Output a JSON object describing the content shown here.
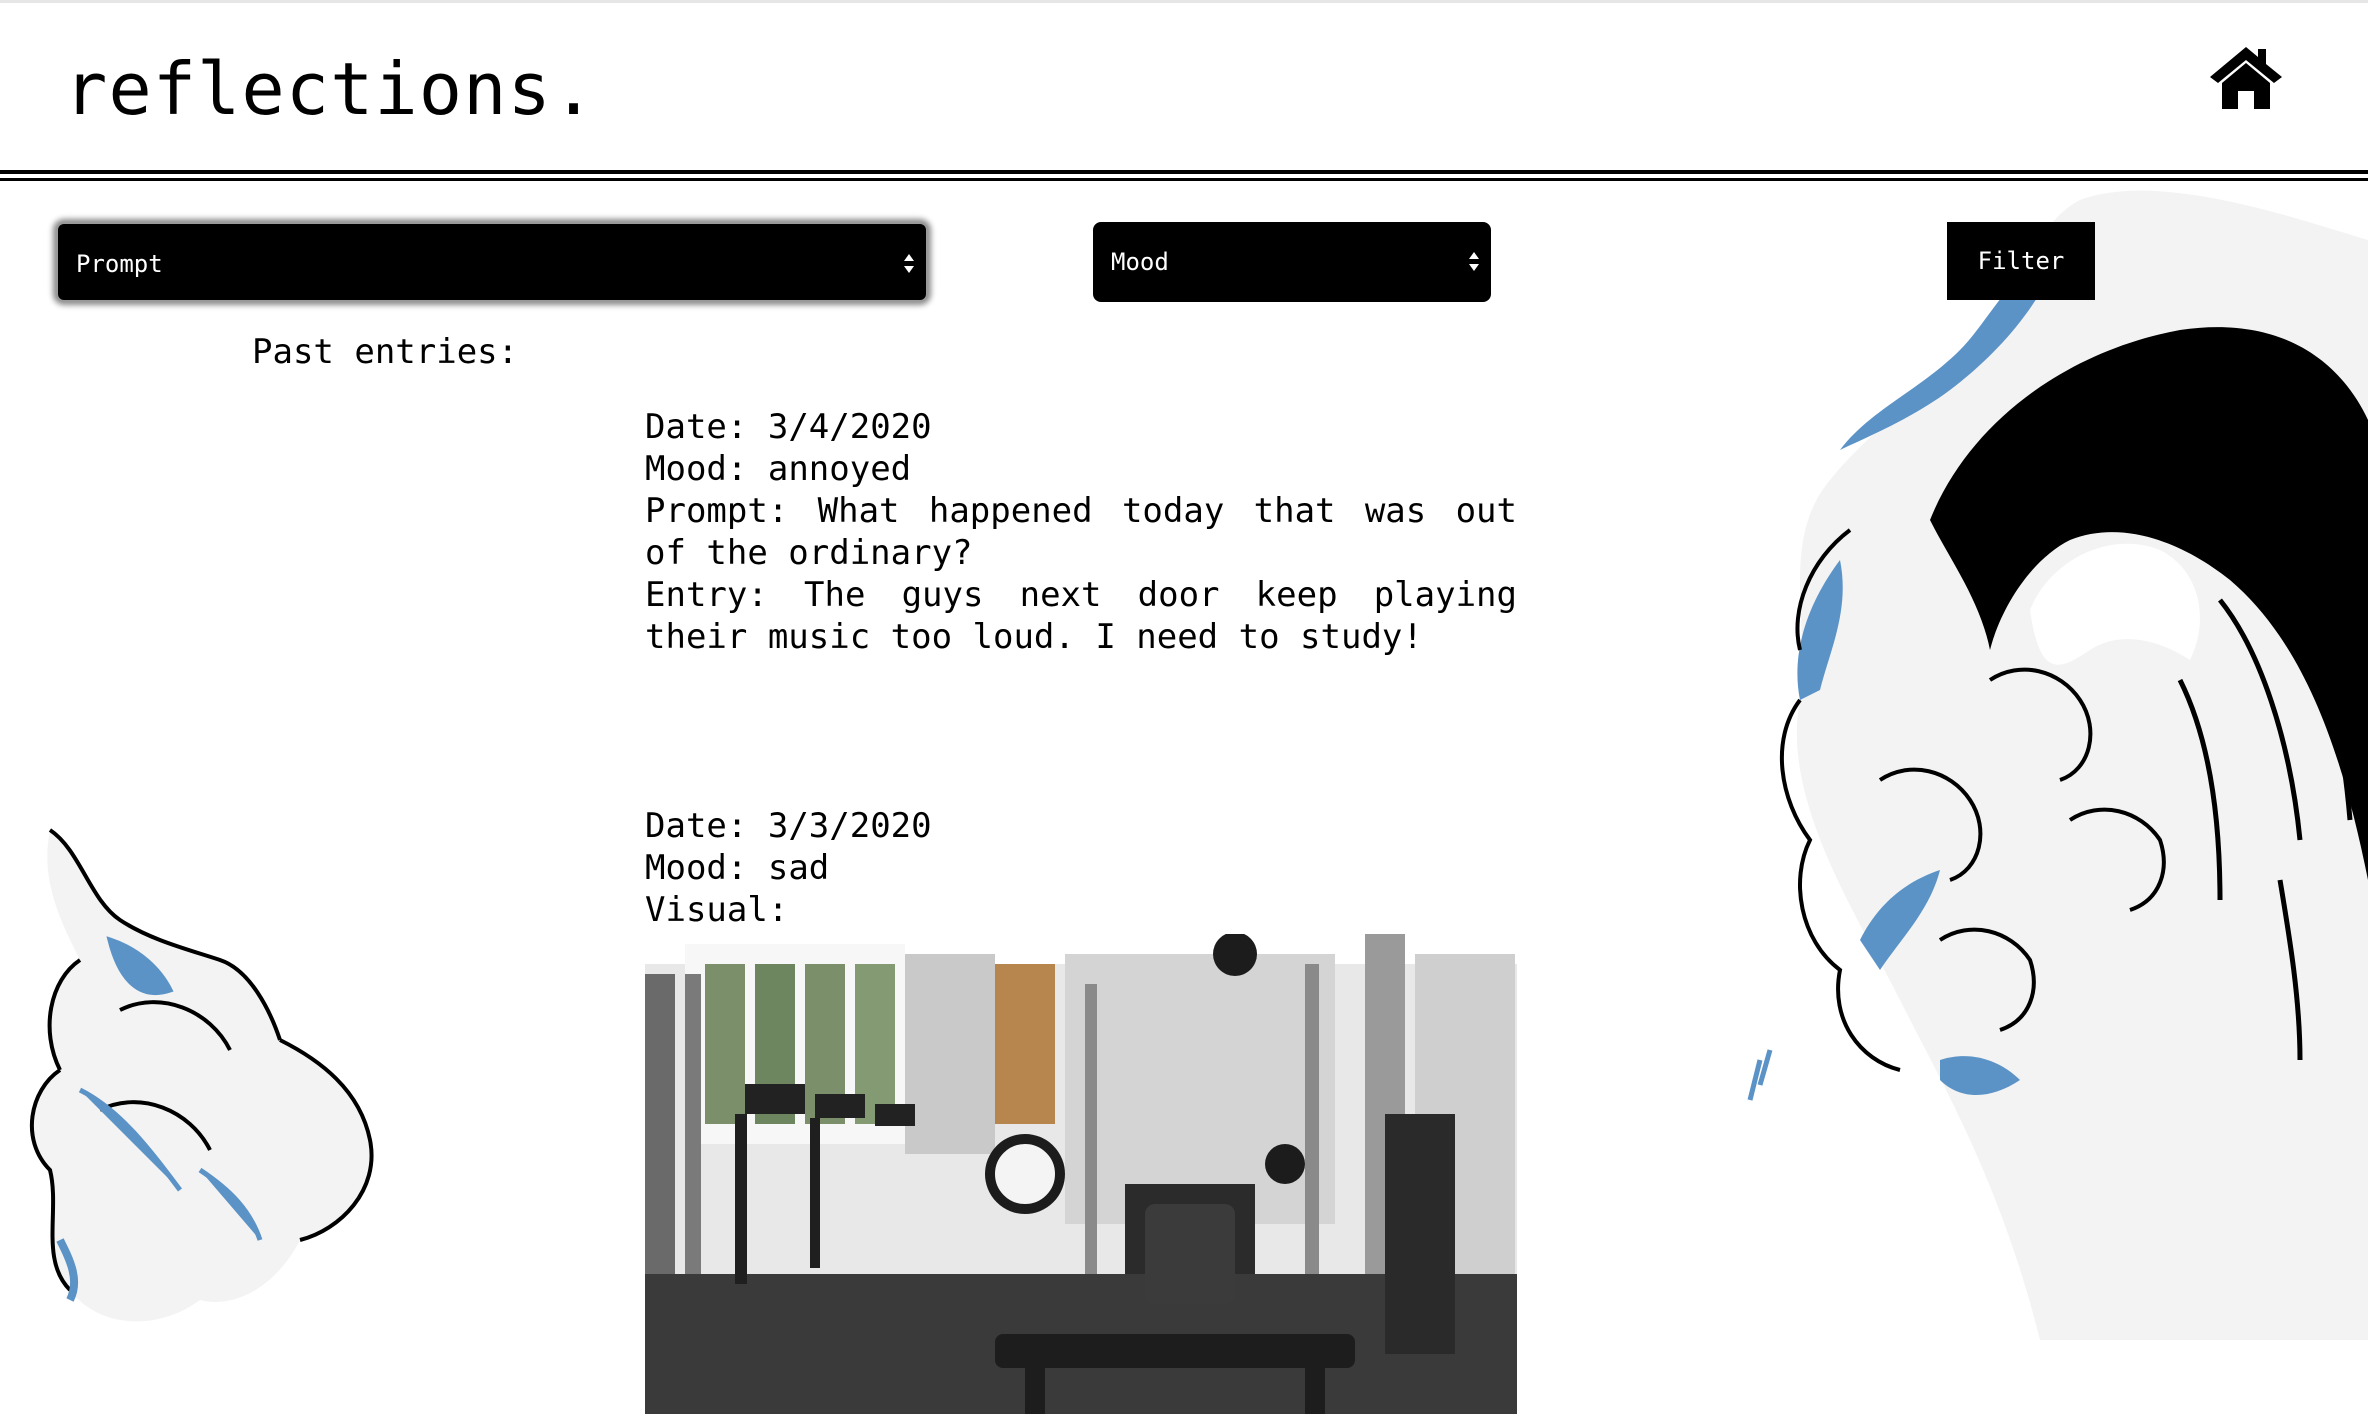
{
  "header": {
    "app_title": "reflections."
  },
  "filters": {
    "prompt_select": "Prompt",
    "mood_select": "Mood",
    "filter_button": "Filter"
  },
  "past_entries_label": "Past entries:",
  "entries": [
    {
      "date_label": "Date:",
      "date": "3/4/2020",
      "mood_label": "Mood:",
      "mood": "annoyed",
      "prompt_label": "Prompt:",
      "prompt": "What happened today that was out of the ordinary?",
      "entry_label": "Entry:",
      "entry": "The guys next door keep playing their music too loud. I need to study!"
    },
    {
      "date_label": "Date:",
      "date": "3/3/2020",
      "mood_label": "Mood:",
      "mood": "sad",
      "visual_label": "Visual:",
      "visual_image": "gym-photo"
    }
  ],
  "icons": {
    "home": "home-icon"
  },
  "colors": {
    "accent_blue": "#5b93c7",
    "control_bg": "#000000",
    "control_text": "#ffffff"
  }
}
